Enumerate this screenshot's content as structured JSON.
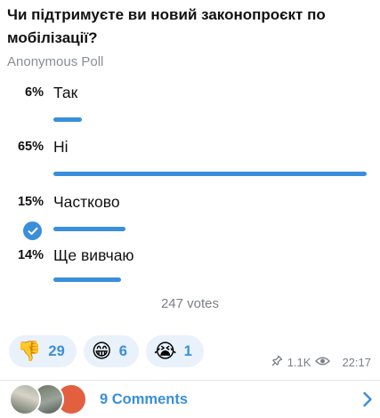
{
  "poll": {
    "question": "Чи підтримуєте ви новий законопроєкт по мобілізації?",
    "type": "Anonymous Poll",
    "options": [
      {
        "percent_label": "6%",
        "label": "Так",
        "percent": 6,
        "voted": false
      },
      {
        "percent_label": "65%",
        "label": "Ні",
        "percent": 65,
        "voted": false
      },
      {
        "percent_label": "15%",
        "label": "Частково",
        "percent": 15,
        "voted": true
      },
      {
        "percent_label": "14%",
        "label": "Ще вивчаю",
        "percent": 14,
        "voted": false
      }
    ],
    "votes": "247 votes"
  },
  "reactions": [
    {
      "emoji": "👎",
      "icon": "thumbs-down-icon",
      "count": "29"
    },
    {
      "emoji": "😁",
      "icon": "grinning-face-icon",
      "count": "6"
    },
    {
      "emoji": "😭",
      "icon": "crying-face-icon",
      "count": "1"
    }
  ],
  "meta": {
    "views": "1.1K",
    "time": "22:17"
  },
  "comments": {
    "label": "9 Comments"
  },
  "colors": {
    "accent": "#3a8fdc",
    "reaction_bg": "#e9f1fb",
    "muted": "#7b8087"
  }
}
